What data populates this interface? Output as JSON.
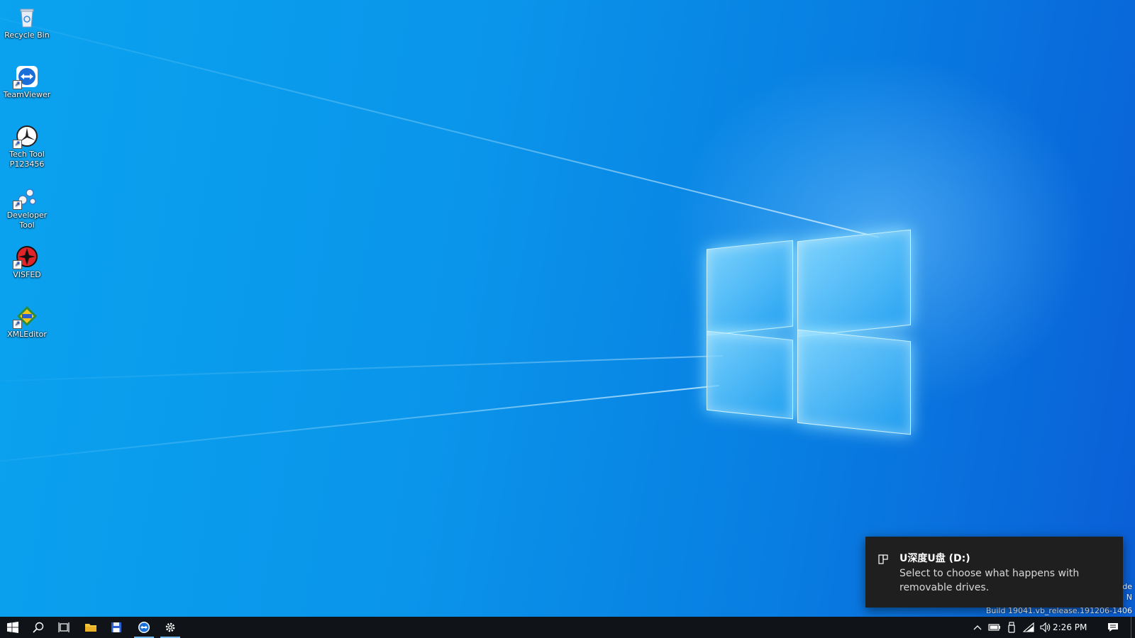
{
  "desktop": {
    "icons": [
      {
        "label": "Recycle Bin",
        "icon": "recycle-bin-icon"
      },
      {
        "label": "TeamViewer",
        "icon": "teamviewer-icon"
      },
      {
        "label": "Tech Tool\nP123456",
        "icon": "tech-tool-icon"
      },
      {
        "label": "Developer\nTool",
        "icon": "developer-tool-icon"
      },
      {
        "label": "VISFED",
        "icon": "visfed-icon"
      },
      {
        "label": "XMLEditor",
        "icon": "xml-editor-icon"
      }
    ]
  },
  "notification": {
    "icon": "usb-drive-icon",
    "title": "U深度U盘 (D:)",
    "body": "Select to choose what happens with removable drives."
  },
  "watermark": {
    "line1": "de",
    "line2": "N",
    "build": "Build 19041.vb_release.191206-1406"
  },
  "taskbar": {
    "clock": "2:26 PM",
    "buttons": [
      "start-icon",
      "search-icon",
      "task-view-icon",
      "file-explorer-icon",
      "save-app-icon",
      "teamviewer-icon",
      "settings-gear-icon"
    ],
    "tray": [
      "chevron-up-icon",
      "battery-icon",
      "usb-icon",
      "wifi-icon",
      "volume-icon"
    ],
    "colors": {
      "taskbar": "#101318",
      "accent": "#76b9ed",
      "toast": "#1f1f1f"
    }
  }
}
